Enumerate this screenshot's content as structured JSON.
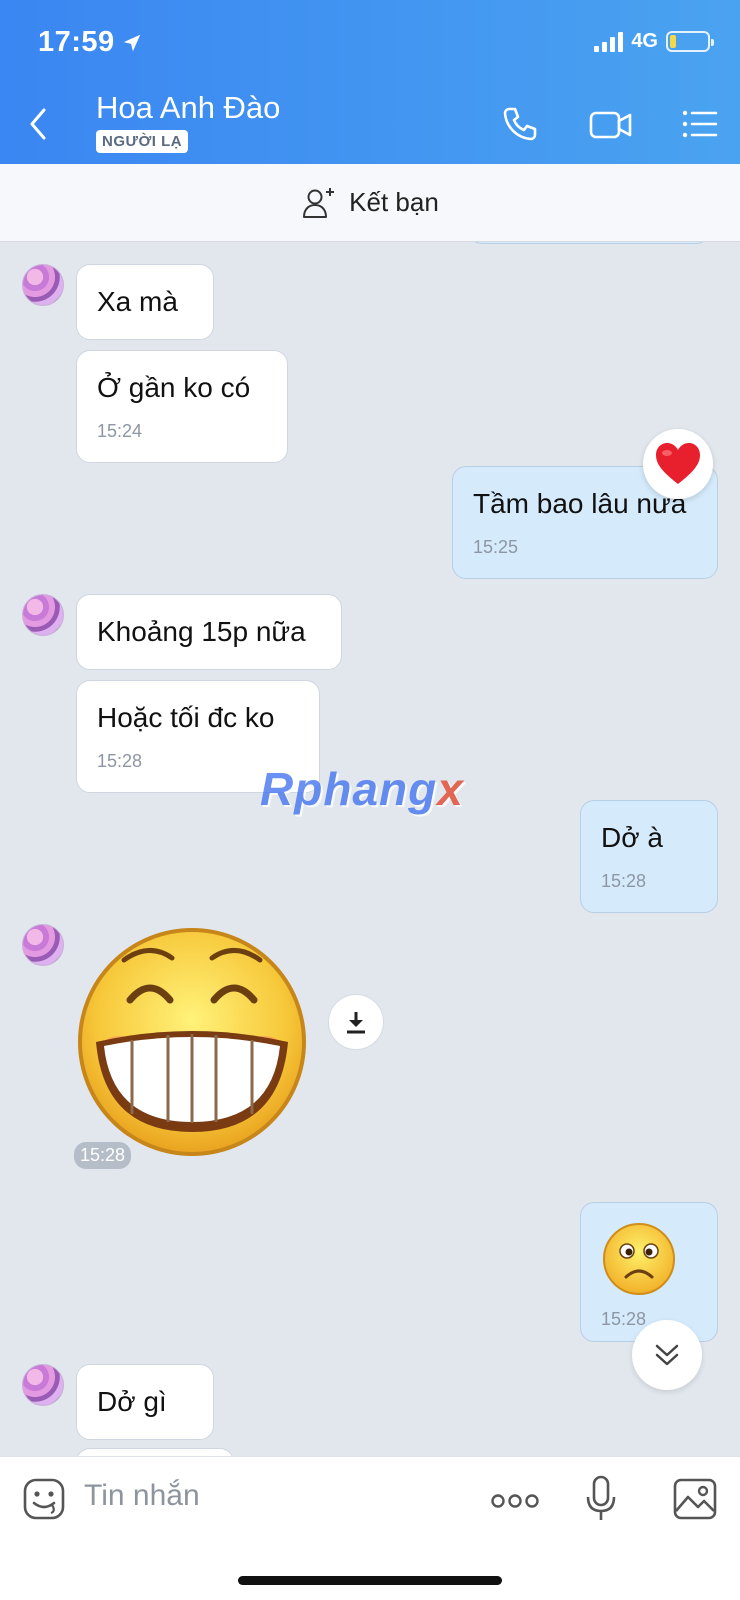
{
  "status": {
    "time": "17:59",
    "network": "4G"
  },
  "header": {
    "contact_name": "Hoa Anh Đào",
    "badge": "NGƯỜI LẠ"
  },
  "friend_bar": {
    "label": "Kết bạn"
  },
  "messages": [
    {
      "side": "in",
      "text": "Xa mà",
      "time": ""
    },
    {
      "side": "in",
      "text": "Ở gần ko có",
      "time": "15:24"
    },
    {
      "side": "out",
      "text": "Tầm bao lâu nưa",
      "time": "15:25",
      "reaction": "heart"
    },
    {
      "side": "in",
      "text": "Khoảng 15p nữa",
      "time": ""
    },
    {
      "side": "in",
      "text": "Hoặc tối đc ko",
      "time": "15:28"
    },
    {
      "side": "out",
      "text": "Dở à",
      "time": "15:28"
    },
    {
      "side": "in",
      "sticker": "grinning-face-sticker",
      "time": "15:28"
    },
    {
      "side": "out",
      "sticker": "frowning-emoji",
      "time": "15:28"
    },
    {
      "side": "in",
      "text": "Dở gì",
      "time": ""
    }
  ],
  "watermark": {
    "main": "Rphang",
    "accent": "x"
  },
  "input": {
    "placeholder": "Tin nhắn"
  },
  "colors": {
    "header_start": "#3a86f2",
    "header_end": "#4aa3f0",
    "outgoing_bubble": "#d5ebfb",
    "chat_bg": "#e2e7ee"
  }
}
